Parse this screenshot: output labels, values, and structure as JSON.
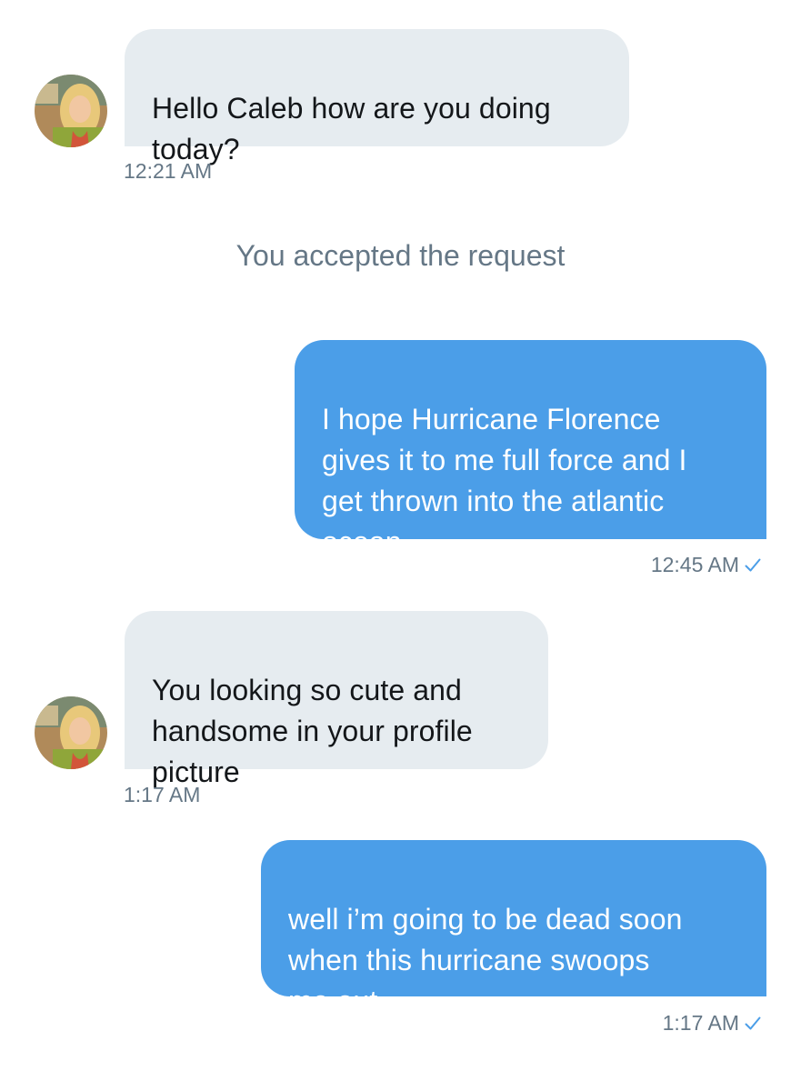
{
  "conversation": {
    "messages": [
      {
        "sender": "them",
        "text": "Hello Caleb how are you doing\ntoday?",
        "time": "12:21 AM"
      },
      {
        "sender": "me",
        "text": "I hope Hurricane Florence\ngives it to me full force and I\nget thrown into the atlantic\nocean",
        "time": "12:45 AM",
        "status_icon": "checkmark-icon"
      },
      {
        "sender": "them",
        "text": "You looking so cute and\nhandsome in your profile\npicture",
        "time": "1:17 AM"
      },
      {
        "sender": "me",
        "text": "well i’m going to be dead soon\nwhen this hurricane swoops\nme out",
        "time": "1:17 AM",
        "status_icon": "checkmark-icon"
      }
    ],
    "system_message": "You accepted the request"
  },
  "colors": {
    "incoming_bubble": "#e6ecf0",
    "outgoing_bubble": "#4b9ee8",
    "timestamp": "#657786",
    "check": "#4b9ee8"
  }
}
